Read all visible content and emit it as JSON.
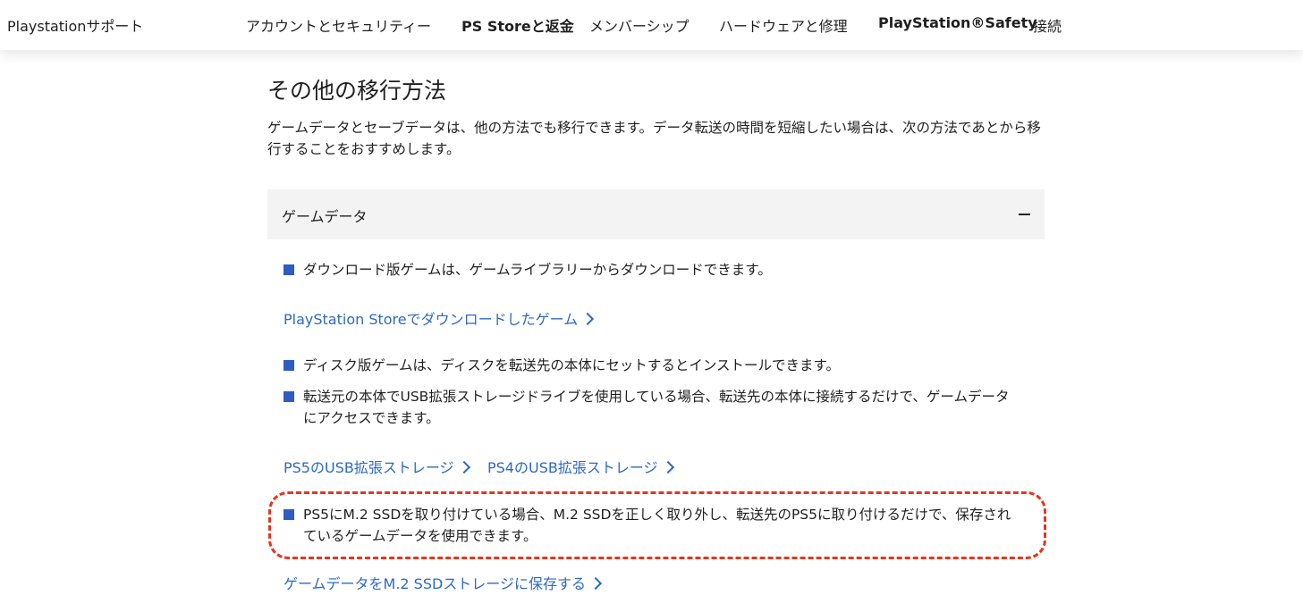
{
  "nav": {
    "brand": "Playstationサポート",
    "items": [
      {
        "label": "アカウントとセキュリティー",
        "bold": false
      },
      {
        "label": "PS Storeと返金",
        "bold": true
      },
      {
        "label": "メンバーシップ",
        "bold": false
      },
      {
        "label": "ハードウェアと修理",
        "bold": false
      },
      {
        "label": "PlayStation®Safety",
        "bold": true
      },
      {
        "label": "接続",
        "bold": false
      }
    ]
  },
  "section": {
    "title": "その他の移行方法",
    "intro": "ゲームデータとセーブデータは、他の方法でも移行できます。データ転送の時間を短縮したい場合は、次の方法であとから移行することをおすすめします。"
  },
  "accordion": {
    "title": "ゲームデータ",
    "toggle_icon": "minus-icon",
    "bullet1": "ダウンロード版ゲームは、ゲームライブラリーからダウンロードできます。",
    "link1": "PlayStation Storeでダウンロードしたゲーム",
    "bullet2": "ディスク版ゲームは、ディスクを転送先の本体にセットするとインストールできます。",
    "bullet3": "転送元の本体でUSB拡張ストレージドライブを使用している場合、転送先の本体に接続するだけで、ゲームデータにアクセスできます。",
    "link2": "PS5のUSB拡張ストレージ",
    "link3": "PS4のUSB拡張ストレージ",
    "bullet4": "PS5にM.2 SSDを取り付けている場合、M.2 SSDを正しく取り外し、転送先のPS5に取り付けるだけで、保存されているゲームデータを使用できます。",
    "link4": "ゲームデータをM.2 SSDストレージに保存する"
  },
  "colors": {
    "link": "#2e69c4",
    "bullet_square": "#2f5cc2",
    "highlight_border": "#e8341f",
    "accordion_bg": "#f3f3f3"
  }
}
